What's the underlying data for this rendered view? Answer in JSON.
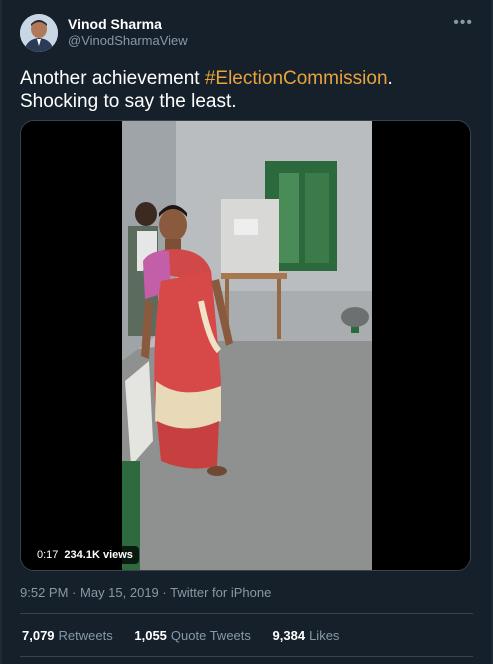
{
  "user": {
    "name": "Vinod Sharma",
    "handle": "@VinodSharmaView"
  },
  "tweet": {
    "text_before": "Another achievement ",
    "hashtag": "#ElectionCommission",
    "text_after": ". Shocking to say the least."
  },
  "video": {
    "duration": "0:17",
    "views": "234.1K views"
  },
  "meta": {
    "time": "9:52 PM",
    "separator": "·",
    "date": "May 15, 2019",
    "source": "Twitter for iPhone"
  },
  "stats": {
    "retweets_count": "7,079",
    "retweets_label": "Retweets",
    "quotes_count": "1,055",
    "quotes_label": "Quote Tweets",
    "likes_count": "9,384",
    "likes_label": "Likes"
  },
  "icons": {
    "more": "more-icon",
    "avatar": "avatar"
  },
  "colors": {
    "background": "#15202b",
    "hashtag": "#e8a33c",
    "secondary_text": "#8899a6",
    "divider": "#38444d"
  }
}
